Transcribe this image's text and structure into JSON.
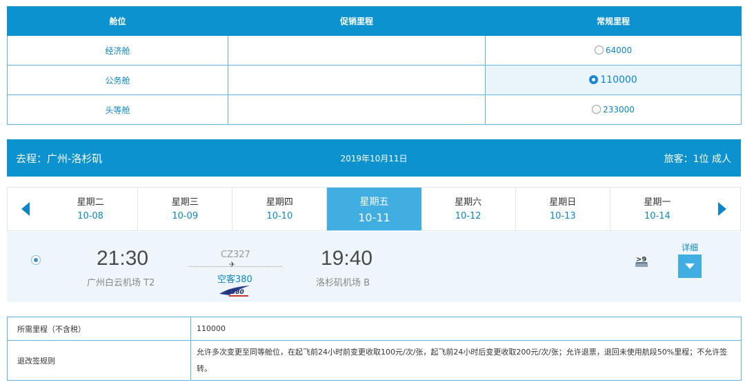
{
  "cabin_table": {
    "headers": [
      "舱位",
      "促销里程",
      "常规里程"
    ],
    "rows": [
      {
        "cabin": "经济舱",
        "promo": "",
        "regular": "64000",
        "selected": false
      },
      {
        "cabin": "公务舱",
        "promo": "",
        "regular": "110000",
        "selected": true
      },
      {
        "cabin": "头等舱",
        "promo": "",
        "regular": "233000",
        "selected": false
      }
    ]
  },
  "route": {
    "title": "去程：广州-洛杉矶",
    "date": "2019年10月11日",
    "passengers": "旅客：1位 成人"
  },
  "date_strip": {
    "days": [
      {
        "weekday": "星期二",
        "date": "10-08"
      },
      {
        "weekday": "星期三",
        "date": "10-09"
      },
      {
        "weekday": "星期四",
        "date": "10-10"
      },
      {
        "weekday": "星期五",
        "date": "10-11"
      },
      {
        "weekday": "星期六",
        "date": "10-12"
      },
      {
        "weekday": "星期日",
        "date": "10-13"
      },
      {
        "weekday": "星期一",
        "date": "10-14"
      }
    ],
    "active_index": 3
  },
  "flight": {
    "departure_time": "21:30",
    "departure_airport": "广州白云机场 T2",
    "flight_number": "CZ327",
    "aircraft": "空客380",
    "arrival_time": "19:40",
    "arrival_airport": "洛杉矶机场 B",
    "seats": ">9",
    "detail_label": "详细"
  },
  "rules": {
    "mileage_label": "所需里程（不含税）",
    "mileage_value": "110000",
    "change_label": "退改签规则",
    "change_value": "允许多次变更至同等舱位，在起飞前24小时前变更收取100元/次/张，起飞前24小时后变更收取200元/次/张；允许退票，退回未使用航段50%里程；不允许签转。"
  },
  "colors": {
    "primary": "#0c92cf",
    "active_tab": "#40aee0",
    "link": "#0c86c8",
    "row_highlight": "#eef6fb"
  }
}
